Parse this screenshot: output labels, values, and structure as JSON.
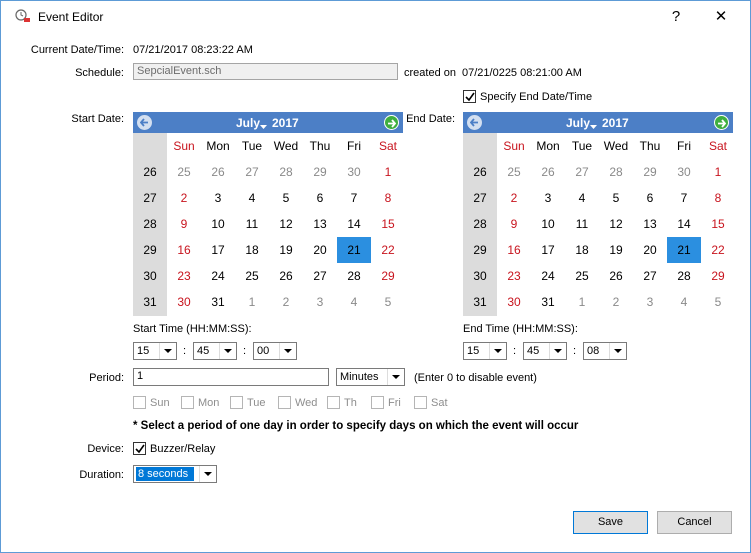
{
  "window": {
    "title": "Event Editor",
    "help": "?",
    "close": "✕"
  },
  "current": {
    "label": "Current Date/Time:",
    "value": "07/21/2017  08:23:22 AM"
  },
  "schedule": {
    "label": "Schedule:",
    "value": "SepcialEvent.sch",
    "created_label": "created on",
    "created_value": "07/21/0225  08:21:00 AM"
  },
  "end_toggle": {
    "label": "Specify End Date/Time",
    "checked": true
  },
  "start": {
    "label": "Start Date:",
    "month": "July",
    "year": "2017",
    "time_label": "Start Time (HH:MM:SS):",
    "hh": "15",
    "mm": "45",
    "ss": "00"
  },
  "end": {
    "label": "End Date:",
    "month": "July",
    "year": "2017",
    "time_label": "End Time (HH:MM:SS):",
    "hh": "15",
    "mm": "45",
    "ss": "08"
  },
  "calendar": {
    "dow": [
      "Sun",
      "Mon",
      "Tue",
      "Wed",
      "Thu",
      "Fri",
      "Sat"
    ],
    "weeks": [
      "26",
      "27",
      "28",
      "29",
      "30",
      "31"
    ],
    "days": [
      [
        "25",
        "26",
        "27",
        "28",
        "29",
        "30",
        "1"
      ],
      [
        "2",
        "3",
        "4",
        "5",
        "6",
        "7",
        "8"
      ],
      [
        "9",
        "10",
        "11",
        "12",
        "13",
        "14",
        "15"
      ],
      [
        "16",
        "17",
        "18",
        "19",
        "20",
        "21",
        "22"
      ],
      [
        "23",
        "24",
        "25",
        "26",
        "27",
        "28",
        "29"
      ],
      [
        "30",
        "31",
        "1",
        "2",
        "3",
        "4",
        "5"
      ]
    ],
    "selected": "21"
  },
  "time_sep": ":",
  "period": {
    "label": "Period:",
    "value": "1",
    "unit": "Minutes",
    "hint": "(Enter 0 to disable event)"
  },
  "days": [
    "Sun",
    "Mon",
    "Tue",
    "Wed",
    "Th",
    "Fri",
    "Sat"
  ],
  "note": "* Select a period of one day in order to specify days on which the event will occur",
  "device": {
    "label": "Device:",
    "option": "Buzzer/Relay",
    "checked": true
  },
  "duration": {
    "label": "Duration:",
    "value": "8 seconds"
  },
  "buttons": {
    "save": "Save",
    "cancel": "Cancel"
  },
  "colors": {
    "cal_header": "#4c7fc6",
    "selected": "#2b8fe0",
    "weekend": "#c8141e"
  }
}
